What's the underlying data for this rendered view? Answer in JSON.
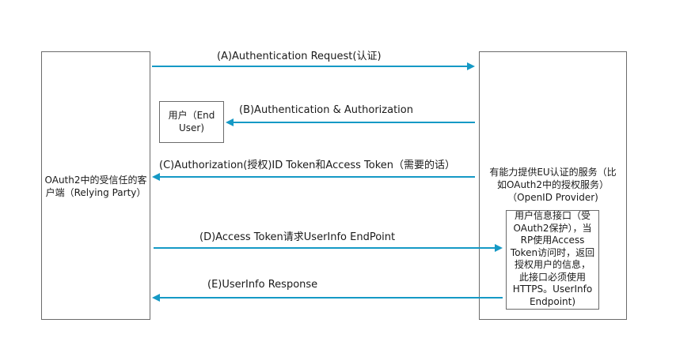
{
  "participants": {
    "relying_party": "OAuth2中的受信任的客\n户端（Relying Party）",
    "openid_provider": "有能力提供EU认证的服务（比\n如OAuth2中的授权服务）\n（OpenID Provider)",
    "end_user": "用户（End\nUser)",
    "userinfo_endpoint": "用户信息接口（受\nOAuth2保护），当\nRP使用Access\nToken访问时，返回\n授权用户的信息，\n此接口必须使用\nHTTPS。UserInfo\nEndpoint)"
  },
  "messages": [
    {
      "id": "A",
      "label": "(A)Authentication Request(认证)",
      "from": "relying_party",
      "to": "openid_provider"
    },
    {
      "id": "B",
      "label": "(B)Authentication & Authorization",
      "from": "openid_provider",
      "to": "end_user"
    },
    {
      "id": "C",
      "label": "(C)Authorization(授权)ID Token和Access Token（需要的话）",
      "from": "openid_provider",
      "to": "relying_party"
    },
    {
      "id": "D",
      "label": "(D)Access Token请求UserInfo EndPoint",
      "from": "relying_party",
      "to": "userinfo_endpoint"
    },
    {
      "id": "E",
      "label": "(E)UserInfo Response",
      "from": "userinfo_endpoint",
      "to": "relying_party"
    }
  ],
  "colors": {
    "arrow": "#1599c5",
    "box_border": "#6b6b6b",
    "text": "#1a1a1a"
  }
}
